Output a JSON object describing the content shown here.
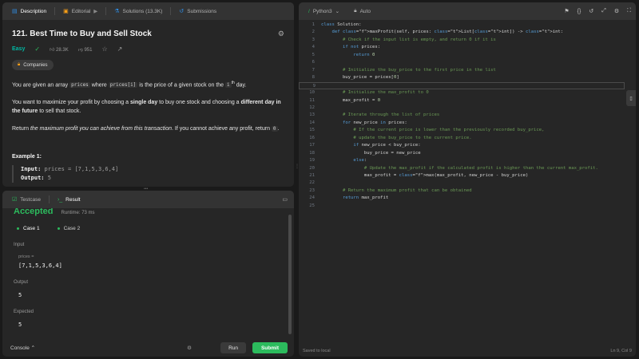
{
  "desc_tabs": [
    {
      "label": "Description",
      "icon": "doc-icon"
    },
    {
      "label": "Editorial",
      "icon": "book-icon"
    },
    {
      "label": "Solutions (13.3K)",
      "icon": "flask-icon"
    },
    {
      "label": "Submissions",
      "icon": "history-icon"
    }
  ],
  "problem": {
    "title": "121. Best Time to Buy and Sell Stock",
    "difficulty": "Easy",
    "likes": "28.3K",
    "dislikes": "951",
    "companies": "Companies",
    "p1_a": "You are given an array ",
    "p1_code1": "prices",
    "p1_b": " where ",
    "p1_code2": "prices[i]",
    "p1_c": " is the price of a given stock on the ",
    "p1_sup_pre": "i",
    "p1_sup": "th",
    "p1_d": " day.",
    "p2_a": "You want to maximize your profit by choosing a ",
    "p2_bold1": "single day",
    "p2_b": " to buy one stock and choosing a ",
    "p2_bold2": "different day in the future",
    "p2_c": " to sell that stock.",
    "p3_a": "Return ",
    "p3_em": "the maximum profit you can achieve from this transaction",
    "p3_b": ". If you cannot achieve any profit, return ",
    "p3_code": "0",
    "p3_c": ".",
    "example_title": "Example 1:",
    "ex_input_label": "Input:",
    "ex_input_val": "prices = [7,1,5,3,6,4]",
    "ex_output_label": "Output:",
    "ex_output_val": "5"
  },
  "test_tabs": [
    {
      "label": "Testcase",
      "icon": "check-box-icon"
    },
    {
      "label": "Result",
      "icon": "terminal-icon"
    }
  ],
  "result": {
    "status": "Accepted",
    "runtime": "Runtime: 73 ms",
    "cases": [
      "Case 1",
      "Case 2"
    ],
    "input_label": "Input",
    "input_sub": "prices =",
    "input_val": "[7,1,5,3,6,4]",
    "output_label": "Output",
    "output_val": "5",
    "expected_label": "Expected",
    "expected_val": "5"
  },
  "footer": {
    "console": "Console",
    "run": "Run",
    "submit": "Submit"
  },
  "editor": {
    "language": "Python3",
    "mode": "Auto",
    "saved": "Saved to local",
    "cursor": "Ln 9, Col 9",
    "lines": [
      "class Solution:",
      "    def maxProfit(self, prices: List[int]) -> int:",
      "        # Check if the input list is empty, and return 0 if it is",
      "        if not prices:",
      "            return 0",
      "",
      "        # Initialize the buy_price to the first price in the list",
      "        buy_price = prices[0]",
      "",
      "        # Initialize the max_profit to 0",
      "        max_profit = 0",
      "",
      "        # Iterate through the list of prices",
      "        for new_price in prices:",
      "            # If the current price is lower than the previously recorded buy_price,",
      "            # update the buy_price to the current price.",
      "            if new_price < buy_price:",
      "                buy_price = new_price",
      "            else:",
      "                # Update the max_profit if the calculated profit is higher than the current max_profit.",
      "                max_profit = max(max_profit, new_price - buy_price)",
      "",
      "        # Return the maximum profit that can be obtained",
      "        return max_profit",
      ""
    ]
  },
  "colors": {
    "accent": "#ffa116",
    "accepted": "#2cbb5d",
    "easy": "#00b8a3"
  }
}
